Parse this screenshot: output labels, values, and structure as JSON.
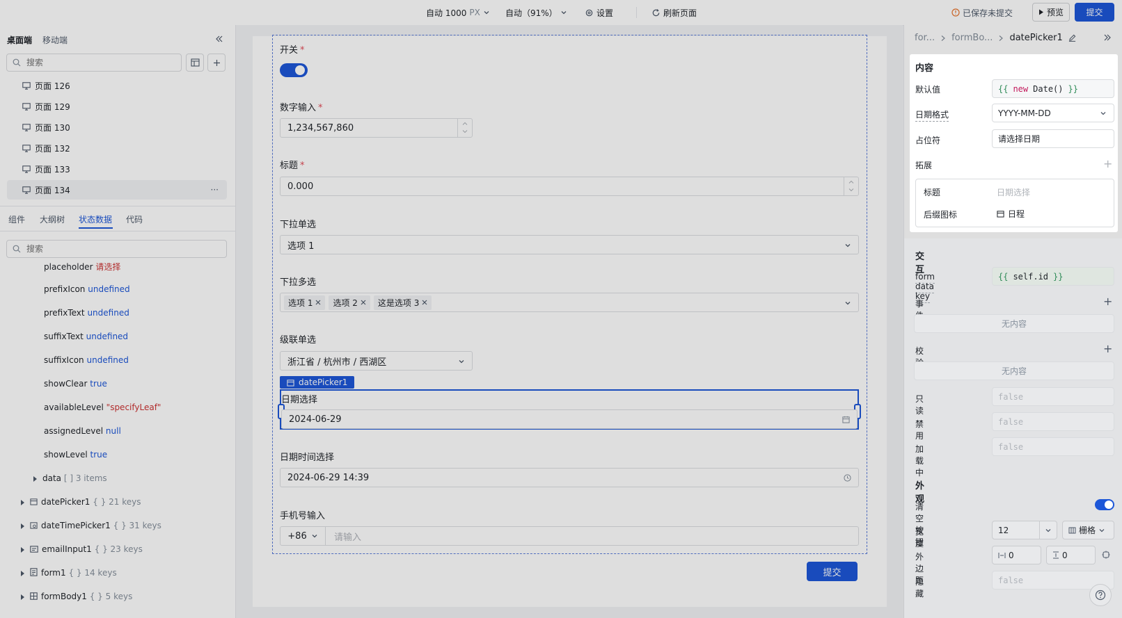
{
  "topbar": {
    "width_label": "自动 1000",
    "width_unit": "PX",
    "zoom_label": "自动（91%）",
    "settings_label": "设置",
    "refresh_label": "刷新页面",
    "unsaved_label": "已保存未提交",
    "preview_label": "预览",
    "submit_label": "提交"
  },
  "left": {
    "tab_desktop": "桌面端",
    "tab_mobile": "移动端",
    "search_placeholder": "搜索",
    "pages": [
      "页面 126",
      "页面 129",
      "页面 130",
      "页面 132",
      "页面 133",
      "页面 134"
    ],
    "more_label": "···",
    "bottom_tabs": [
      "组件",
      "大纲树",
      "状态数据",
      "代码"
    ],
    "state_search_placeholder": "搜索",
    "state_cut": {
      "key": "placeholder",
      "value": "请选择"
    },
    "state_rows": [
      {
        "key": "prefixIcon",
        "value": "undefined"
      },
      {
        "key": "prefixText",
        "value": "undefined"
      },
      {
        "key": "suffixText",
        "value": "undefined"
      },
      {
        "key": "suffixIcon",
        "value": "undefined"
      },
      {
        "key": "showClear",
        "value": "true"
      },
      {
        "key": "availableLevel",
        "value": "\"specifyLeaf\""
      },
      {
        "key": "assignedLevel",
        "value": "null"
      },
      {
        "key": "showLevel",
        "value": "true"
      }
    ],
    "data_row": {
      "key": "data",
      "meta": "[ ] 3 items"
    },
    "components": [
      {
        "key": "datePicker1",
        "meta": "{ } 21 keys"
      },
      {
        "key": "dateTimePicker1",
        "meta": "{ } 31 keys"
      },
      {
        "key": "emailInput1",
        "meta": "{ } 23 keys"
      },
      {
        "key": "form1",
        "meta": "{ } 14 keys"
      },
      {
        "key": "formBody1",
        "meta": "{ } 5 keys"
      }
    ]
  },
  "canvas": {
    "switch_label": "开关",
    "number_label": "数字输入",
    "number_value": "1,234,567,860",
    "title_label": "标题",
    "title_value": "0.000",
    "select_label": "下拉单选",
    "select_value": "选项 1",
    "multi_label": "下拉多选",
    "multi_tags": [
      "选项 1",
      "选项 2",
      "这是选项 3"
    ],
    "cascader_label": "级联单选",
    "cascader_value": "浙江省 / 杭州市 / 西湖区",
    "selected_badge": "datePicker1",
    "date_label": "日期选择",
    "date_value": "2024-06-29",
    "datetime_label": "日期时间选择",
    "datetime_value": "2024-06-29 14:39",
    "phone_label": "手机号输入",
    "phone_prefix": "+86",
    "phone_placeholder": "请输入",
    "submit_label": "提交",
    "required_mark": "*"
  },
  "right": {
    "breadcrumb": [
      "for...",
      "formBo...",
      "datePicker1"
    ],
    "content_title": "内容",
    "default_label": "默认值",
    "default_open": "{{",
    "default_kw": "new",
    "default_expr": "Date()",
    "default_close": "}}",
    "format_label": "日期格式",
    "format_value": "YYYY-MM-DD",
    "placeholder_label": "占位符",
    "placeholder_value": "请选择日期",
    "extend_label": "拓展",
    "ext_title_label": "标题",
    "ext_title_value": "日期选择",
    "ext_suffix_label": "后缀图标",
    "ext_suffix_value": "日程",
    "interaction_title": "交互",
    "form_key_label": "form data key",
    "form_key_open": "{{",
    "form_key_expr": "self.id",
    "form_key_close": "}}",
    "events_label": "事件",
    "events_empty": "无内容",
    "validate_label": "校验",
    "validate_empty": "无内容",
    "readonly_label": "只读",
    "readonly_value": "false",
    "disabled_label": "禁用",
    "disabled_value": "false",
    "loading_label": "加载中",
    "loading_value": "false",
    "appearance_title": "外观",
    "clear_label": "清空按钮",
    "width_label": "宽度",
    "width_value": "12",
    "grid_label": "栅格",
    "margin_label": "外边距",
    "margin_h": "0",
    "margin_v": "0",
    "hidden_label": "隐藏",
    "hidden_value": "false"
  },
  "colors": {
    "primary": "#1d57d8",
    "toggle": "#1d57d8",
    "required": "#e34d59",
    "code_green": "#2e8b57",
    "code_keyword": "#c2185b"
  }
}
